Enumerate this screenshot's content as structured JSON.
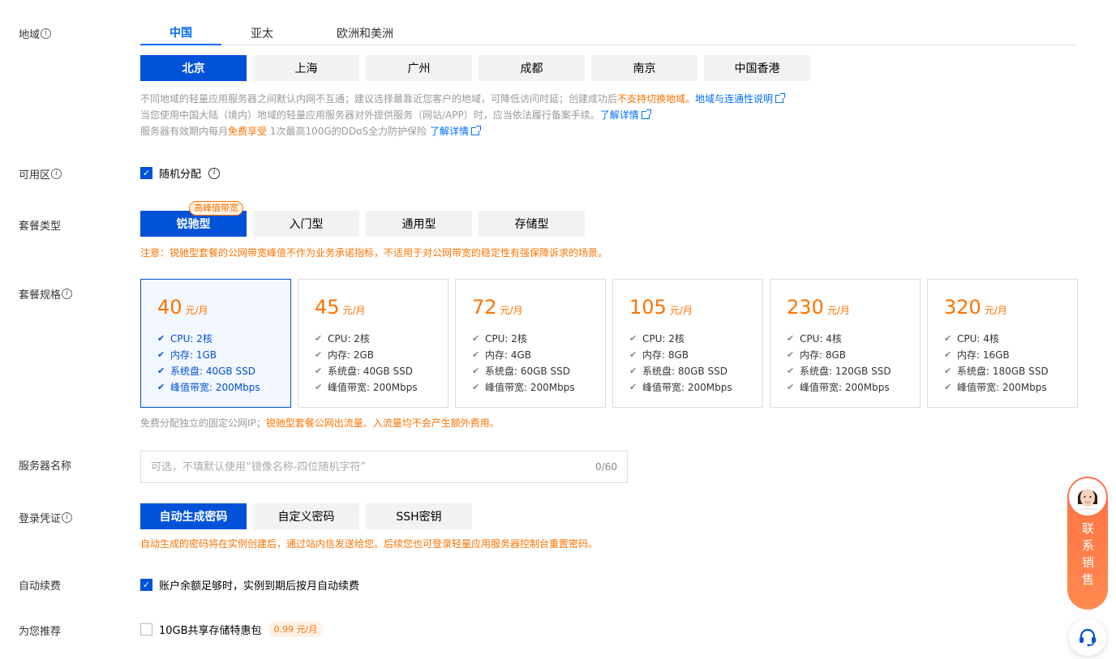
{
  "region": {
    "label": "地域",
    "tabs": [
      "中国",
      "亚太",
      "欧洲和美洲"
    ],
    "cities": [
      "北京",
      "上海",
      "广州",
      "成都",
      "南京",
      "中国香港"
    ],
    "hint1_text": "不同地域的轻量应用服务器之间默认内网不互通；建议选择最靠近您客户的地域，可降低访问时延；创建成功后",
    "hint1_warn": "不支持切换地域。",
    "hint1_link": "地域与连通性说明",
    "hint2_text": "当您使用中国大陆（境内）地域的轻量应用服务器对外提供服务（网站/APP）时，应当依法履行备案手续。",
    "hint2_link": "了解详情",
    "hint3_text_a": "服务器有效期内每月",
    "hint3_warn": "免费享受",
    "hint3_text_b": "1次最高100G的DDoS全力防护保险",
    "hint3_link": "了解详情"
  },
  "zone": {
    "label": "可用区",
    "checkbox_label": "随机分配"
  },
  "package_type": {
    "label": "套餐类型",
    "options": [
      "锐驰型",
      "入门型",
      "通用型",
      "存储型"
    ],
    "badge": "高峰值带宽",
    "note": "注意：锐驰型套餐的公网带宽峰值不作为业务承诺指标，不适用于对公网带宽的稳定性有强保障诉求的场景。"
  },
  "package_spec": {
    "label": "套餐规格",
    "unit": "元/月",
    "plans": [
      {
        "price": "40",
        "cpu": "CPU: 2核",
        "mem": "内存: 1GB",
        "disk": "系统盘: 40GB SSD",
        "bw": "峰值带宽: 200Mbps"
      },
      {
        "price": "45",
        "cpu": "CPU: 2核",
        "mem": "内存: 2GB",
        "disk": "系统盘: 40GB SSD",
        "bw": "峰值带宽: 200Mbps"
      },
      {
        "price": "72",
        "cpu": "CPU: 2核",
        "mem": "内存: 4GB",
        "disk": "系统盘: 60GB SSD",
        "bw": "峰值带宽: 200Mbps"
      },
      {
        "price": "105",
        "cpu": "CPU: 2核",
        "mem": "内存: 8GB",
        "disk": "系统盘: 80GB SSD",
        "bw": "峰值带宽: 200Mbps"
      },
      {
        "price": "230",
        "cpu": "CPU: 4核",
        "mem": "内存: 8GB",
        "disk": "系统盘: 120GB SSD",
        "bw": "峰值带宽: 200Mbps"
      },
      {
        "price": "320",
        "cpu": "CPU: 4核",
        "mem": "内存: 16GB",
        "disk": "系统盘: 180GB SSD",
        "bw": "峰值带宽: 200Mbps"
      }
    ],
    "ip_note_gray": "免费分配独立的固定公网IP；",
    "ip_note_orange": "锐驰型套餐公网出流量、入流量均不会产生额外费用。"
  },
  "server_name": {
    "label": "服务器名称",
    "placeholder": "可选，不填默认使用“镜像名称-四位随机字符”",
    "counter": "0/60"
  },
  "credential": {
    "label": "登录凭证",
    "options": [
      "自动生成密码",
      "自定义密码",
      "SSH密钥"
    ],
    "note": "自动生成的密码将在实例创建后，通过站内信发送给您。后续您也可登录轻量应用服务器控制台重置密码。"
  },
  "auto_renew": {
    "label": "自动续费",
    "checkbox_label": "账户余额足够时，实例到期后按月自动续费"
  },
  "recommend": {
    "label": "为您推荐",
    "checkbox_label": "10GB共享存储特惠包",
    "price": "0.99 元/月"
  },
  "float": {
    "contact_label": "联系销售"
  },
  "colors": {
    "primary": "#0052d9",
    "accent_orange": "#ff7200",
    "link": "#006eff"
  }
}
